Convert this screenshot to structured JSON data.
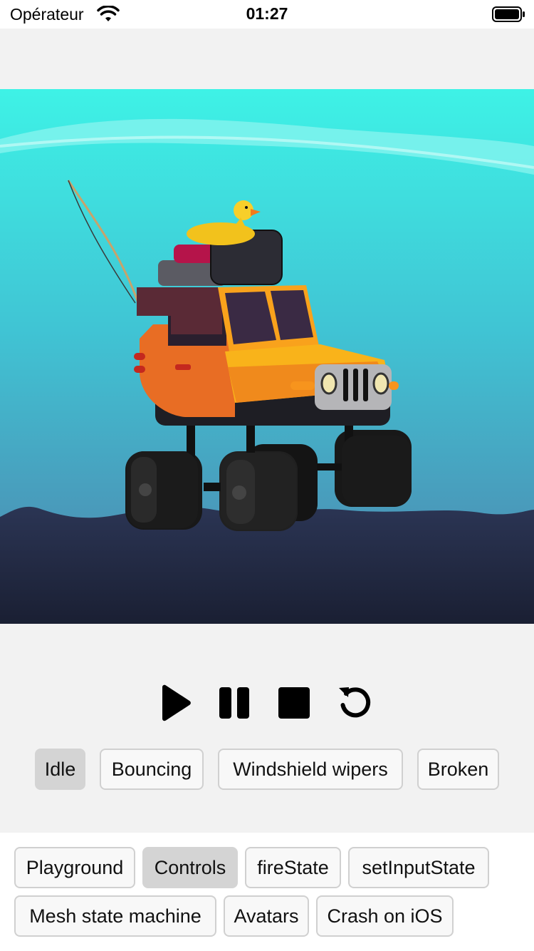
{
  "status_bar": {
    "carrier": "Opérateur",
    "time": "01:27"
  },
  "scene": {
    "sky_top": "#3ef2e6",
    "sky_bottom": "#4a7fa8",
    "ground": "#242c48",
    "vehicle_body": "#f07a22",
    "vehicle_hood": "#f9b31a"
  },
  "playback": {
    "play_icon": "play-icon",
    "pause_icon": "pause-icon",
    "stop_icon": "stop-icon",
    "restart_icon": "restart-icon"
  },
  "animations": [
    "Idle",
    "Bouncing",
    "Windshield wipers",
    "Broken"
  ],
  "selected_animation": "Idle",
  "nav": {
    "row1": [
      "Playground",
      "Controls",
      "fireState",
      "setInputState"
    ],
    "row2": [
      "Mesh state machine",
      "Avatars",
      "Crash on iOS"
    ],
    "selected": "Controls"
  }
}
